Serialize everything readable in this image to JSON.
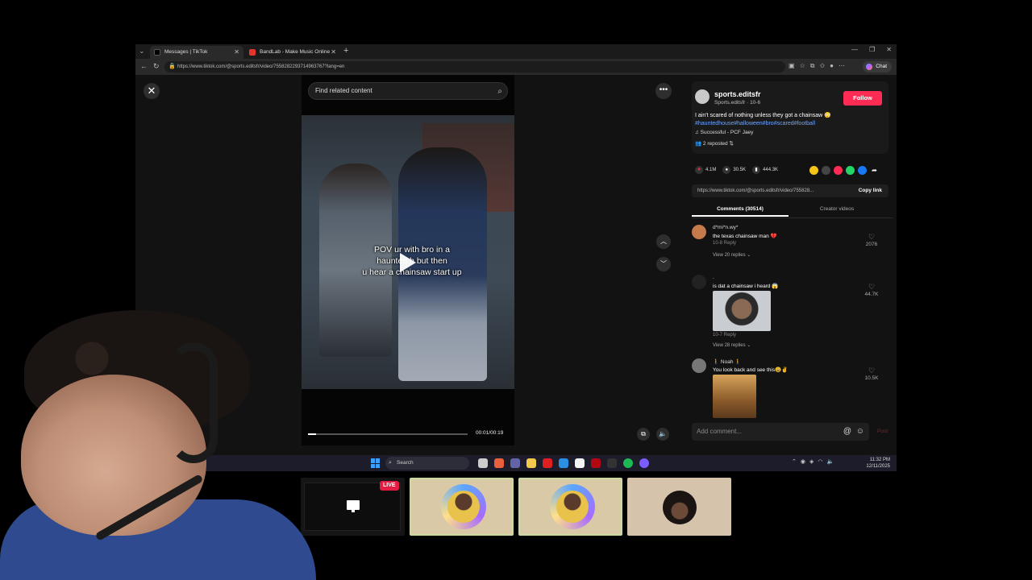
{
  "browser": {
    "tabs": [
      {
        "label": "Messages | TikTok",
        "color": "#000000"
      },
      {
        "label": "BandLab - Make Music Online",
        "color": "#e5352f"
      }
    ],
    "url": "https://www.tiktok.com/@sports.editsfr/video/7558282293714963767?lang=en",
    "chat_label": "Chat"
  },
  "video": {
    "search_placeholder": "Find related content",
    "caption_lines": [
      "POV ur with bro in a",
      "haunted  h       but then",
      "u hear a chainsaw start up"
    ],
    "time": "00:01/00:19",
    "progress": 0.05
  },
  "post": {
    "author": "sports.editsfr",
    "author_sub": "Sports.editsfr · 10-6",
    "follow_label": "Follow",
    "description": "I ain't scared of nothing unless they got a chainsaw 😳",
    "hashtags": "#hauntedhouse#halloween#bro#scared#football",
    "music": "♫  Successful - PCF Jaey",
    "reposted": "👥 2 reposted  ⇅",
    "likes": "4.1M",
    "comments_count": "30.5K",
    "saves": "444.3K",
    "link": "https://www.tiktok.com/@sports.editsfr/video/755828...",
    "copy_link": "Copy link",
    "tab_comments": "Comments (30514)",
    "tab_creator": "Creator videos"
  },
  "comments": [
    {
      "user": "d*mi*n.wy*",
      "text": "the texas chainsaw man 💔",
      "meta": "10-8     Reply",
      "replies": "View 20 replies  ⌄",
      "likes": "2076"
    },
    {
      "user": ".",
      "text": "is dat a chainsaw i heard 😱",
      "meta": "10-7     Reply",
      "replies": "View 28 replies  ⌄",
      "likes": "44.7K"
    },
    {
      "user": "🚶 Noah 🚶",
      "text": "You look back and see this😩✌️",
      "likes": "10.5K"
    }
  ],
  "add_comment": {
    "placeholder": "Add comment...",
    "post_label": "Post"
  },
  "taskbar": {
    "search": "Search",
    "time": "11:32 PM",
    "date": "12/11/2025"
  },
  "stream": {
    "live_label": "LIVE"
  }
}
